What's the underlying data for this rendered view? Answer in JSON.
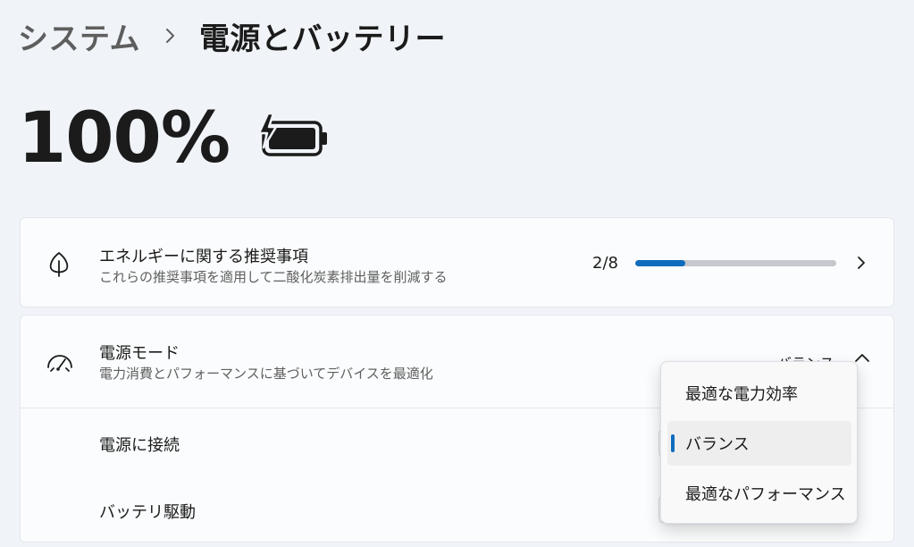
{
  "breadcrumb": {
    "parent": "システム",
    "current": "電源とバッテリー"
  },
  "battery": {
    "percent_label": "100%",
    "level_fraction": 1.0,
    "charging": true
  },
  "recommendations": {
    "title": "エネルギーに関する推奨事項",
    "subtitle": "これらの推奨事項を適用して二酸化炭素排出量を削減する",
    "count_label": "2/8",
    "progress_fraction": 0.25
  },
  "power_mode": {
    "title": "電源モード",
    "subtitle": "電力消費とパフォーマンスに基づいてデバイスを最適化",
    "current_value": "バランス",
    "rows": [
      {
        "label": "電源に接続"
      },
      {
        "label": "バッテリ駆動"
      }
    ],
    "flyout_options": [
      {
        "label": "最適な電力効率",
        "selected": false
      },
      {
        "label": "バランス",
        "selected": true
      },
      {
        "label": "最適なパフォーマンス",
        "selected": false
      }
    ]
  },
  "colors": {
    "accent": "#0f6cbd",
    "background": "#f0f4f9",
    "card": "#fbfcfd"
  },
  "icons": {
    "breadcrumb_separator": "chevron-right-icon",
    "battery": "battery-charging-icon",
    "recommendations": "leaf-icon",
    "power_mode": "gauge-icon",
    "rec_open": "chevron-right-icon",
    "collapse": "chevron-up-icon"
  }
}
